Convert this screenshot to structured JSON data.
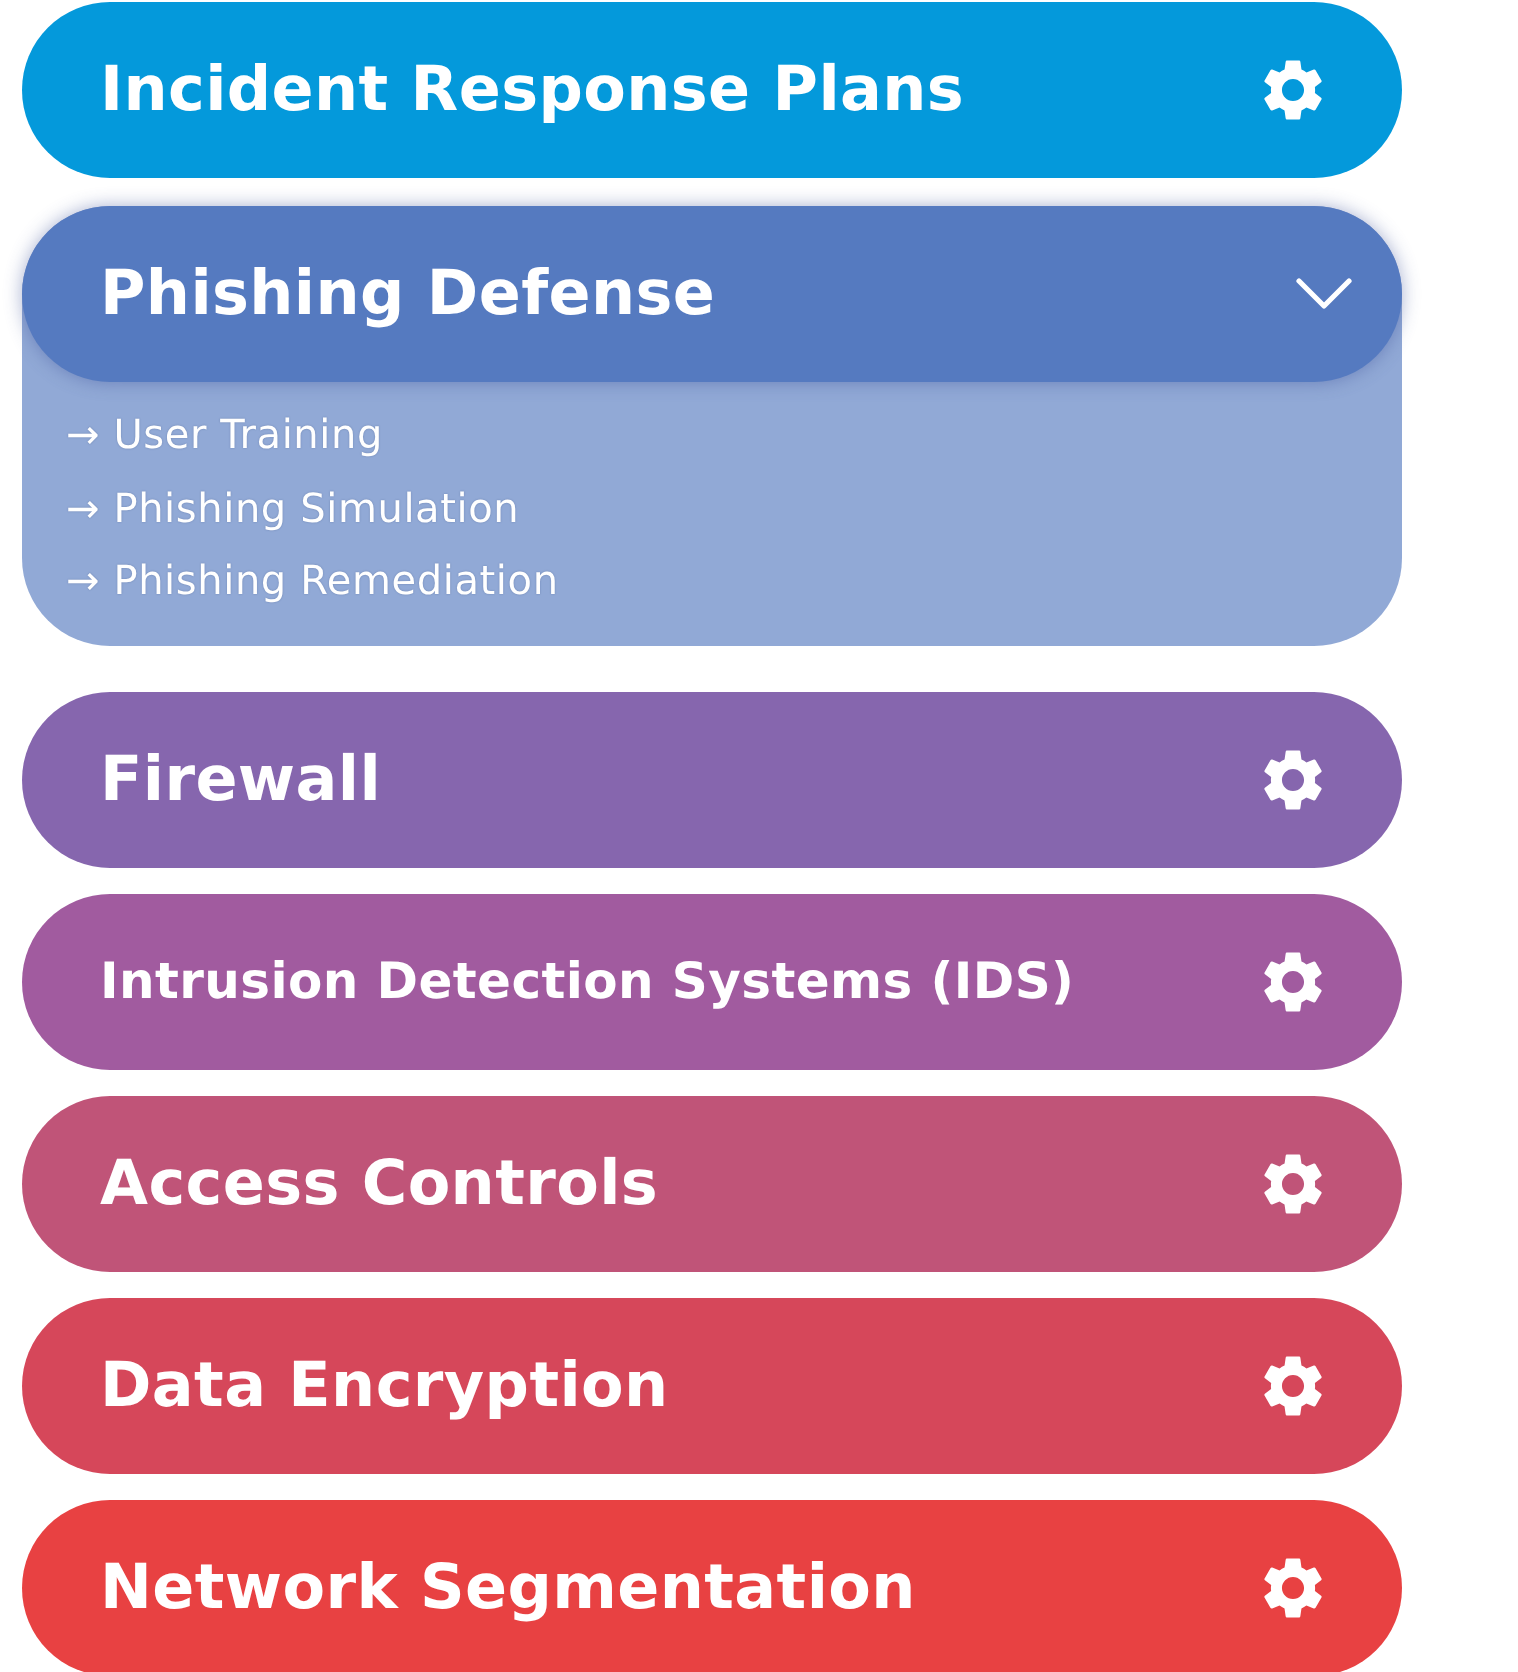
{
  "items": [
    {
      "label": "Incident Response Plans",
      "color": "#0499db",
      "expanded": false
    },
    {
      "label": "Phishing Defense",
      "color": "#557ac0",
      "expanded": true,
      "children": [
        "→ User Training",
        "→ Phishing Simulation",
        "→ Phishing Remediation"
      ]
    },
    {
      "label": "Firewall",
      "color": "#8666ae",
      "expanded": false
    },
    {
      "label": "Intrusion Detection Systems (IDS)",
      "color": "#a15b9f",
      "expanded": false
    },
    {
      "label": "Access Controls",
      "color": "#c05478",
      "expanded": false
    },
    {
      "label": "Data Encryption",
      "color": "#d6475a",
      "expanded": false
    },
    {
      "label": "Network Segmentation",
      "color": "#e84142",
      "expanded": false
    }
  ]
}
